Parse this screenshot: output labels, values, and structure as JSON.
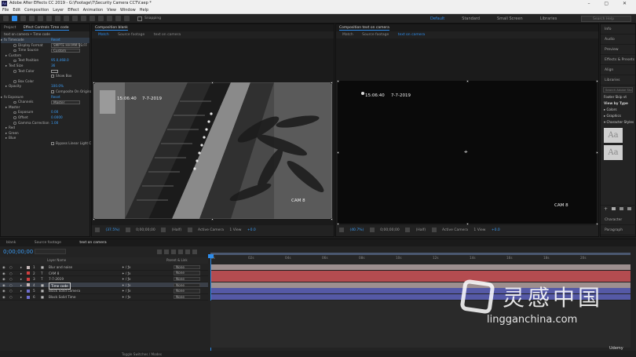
{
  "window": {
    "title": "Adobe After Effects CC 2019 - G:\\Footage\\7\\Security Camera CCTV.aep *"
  },
  "menu": [
    "File",
    "Edit",
    "Composition",
    "Layer",
    "Effect",
    "Animation",
    "View",
    "Window",
    "Help"
  ],
  "toolbar": {
    "snapping_label": "Snapping",
    "workspaces": [
      "Default",
      "Standard",
      "Small Screen",
      "Libraries"
    ],
    "active_workspace": "Default",
    "search_placeholder": "Search Help"
  },
  "effect_controls": {
    "tabs": [
      "Project",
      "Effect Controls Time code"
    ],
    "breadcrumb": "text on camera • Time code",
    "rows": [
      {
        "label": "fx  Timecode",
        "value": "Reset",
        "indent": 0,
        "kind": "value",
        "highlight": true
      },
      {
        "label": "Display Format",
        "value": "SMPTE HH:MM:SS:FF",
        "indent": 2,
        "kind": "select"
      },
      {
        "label": "Time Source",
        "value": "Custom",
        "indent": 2,
        "kind": "select"
      },
      {
        "label": "Custom",
        "value": "",
        "indent": 1,
        "kind": "none"
      },
      {
        "label": "Text Position",
        "value": "95.0,468.0",
        "indent": 2,
        "kind": "value"
      },
      {
        "label": "Text Size",
        "value": "36",
        "indent": 1,
        "kind": "value"
      },
      {
        "label": "Text Color",
        "value": "",
        "indent": 2,
        "kind": "swatch"
      },
      {
        "label": "",
        "value": "Show Box",
        "indent": 2,
        "kind": "check"
      },
      {
        "label": "Box Color",
        "value": "",
        "indent": 2,
        "kind": "none"
      },
      {
        "label": "Opacity",
        "value": "100.0%",
        "indent": 1,
        "kind": "value"
      },
      {
        "label": "",
        "value": "Composite On Original",
        "indent": 2,
        "kind": "check"
      },
      {
        "label": "fx  Exposure",
        "value": "Reset",
        "indent": 0,
        "kind": "value"
      },
      {
        "label": "Channels",
        "value": "Master",
        "indent": 2,
        "kind": "select"
      },
      {
        "label": "Master",
        "value": "",
        "indent": 1,
        "kind": "none"
      },
      {
        "label": "Exposure",
        "value": "0.00",
        "indent": 2,
        "kind": "value"
      },
      {
        "label": "Offset",
        "value": "0.0000",
        "indent": 2,
        "kind": "value"
      },
      {
        "label": "Gamma Correction",
        "value": "1.00",
        "indent": 2,
        "kind": "value"
      },
      {
        "label": "Red",
        "value": "",
        "indent": 1,
        "kind": "none"
      },
      {
        "label": "Green",
        "value": "",
        "indent": 1,
        "kind": "none"
      },
      {
        "label": "Blue",
        "value": "",
        "indent": 1,
        "kind": "none"
      },
      {
        "label": "",
        "value": "Bypass Linear Light Conversion",
        "indent": 2,
        "kind": "check"
      }
    ]
  },
  "viewer_left": {
    "tab": "Composition blank",
    "subtabs": [
      "Match",
      "Source footage",
      "text on camera"
    ],
    "active_subtab": "Match",
    "time_overlay": "15:06:40",
    "date_overlay": "7-7-2019",
    "cam_label": "CAM 8",
    "footer": {
      "zoom": "(37.5%)",
      "timecode": "0;00;00;00",
      "resolution": "(Half)",
      "camera": "Active Camera",
      "views": "1 View",
      "exposure": "+0.0"
    }
  },
  "viewer_right": {
    "tab": "Composition text on camera",
    "subtabs": [
      "Match",
      "Source footage",
      "text on camera"
    ],
    "active_subtab": "text on camera",
    "time_overlay": "15:06:40",
    "date_overlay": "7-7-2019",
    "cam_label": "CAM 8",
    "footer": {
      "zoom": "(40.7%)",
      "timecode": "0;00;00;00",
      "resolution": "(Half)",
      "camera": "Active Camera",
      "views": "1 View",
      "exposure": "+0.0"
    }
  },
  "right_panel": {
    "items": [
      "Info",
      "Audio",
      "Preview",
      "Effects & Presets",
      "Align",
      "Libraries"
    ],
    "libraries_search": "Search Adobe Stock",
    "library_name": "Footer Skip vt",
    "view_by": "View by Type",
    "sections": [
      "Colors",
      "Graphics",
      "Character Styles"
    ],
    "char_style_sample": "Aa",
    "bottom_items": [
      "Character",
      "Paragraph"
    ]
  },
  "timeline": {
    "tabs": [
      "blank",
      "Source footage",
      "text on camera"
    ],
    "active_tab": "text on camera",
    "timecode": "0;00;00;00",
    "columns": {
      "layer": "Layer Name",
      "parent": "Parent & Link"
    },
    "layers": [
      {
        "num": "1",
        "name": "Blur and noise",
        "parent": "None",
        "color": "#c6b8b8",
        "bar": "#9d8f8f"
      },
      {
        "num": "2",
        "name": "CAM 8",
        "parent": "None",
        "color": "#d04040",
        "bar": "#b44c50"
      },
      {
        "num": "3",
        "name": "7-7-2019",
        "parent": "None",
        "color": "#d04040",
        "bar": "#b44c50"
      },
      {
        "num": "4",
        "name": "Time code",
        "parent": "None",
        "color": "#c6b8b8",
        "bar": "#9d8f8f"
      },
      {
        "num": "5",
        "name": "Black Solid camera",
        "parent": "None",
        "color": "#7070d0",
        "bar": "#5559a6"
      },
      {
        "num": "6",
        "name": "Black Solid Time",
        "parent": "None",
        "color": "#7070d0",
        "bar": "#5559a6"
      }
    ],
    "selected_layer": 3,
    "ruler_ticks": [
      "0s",
      "02s",
      "04s",
      "06s",
      "08s",
      "10s",
      "12s",
      "14s",
      "16s",
      "18s",
      "20s"
    ],
    "footer_label": "Toggle Switches / Modes"
  },
  "watermark": {
    "cn": "灵感中国",
    "en": "lingganchina.com",
    "badge": "Udemy"
  },
  "colors": {
    "accent": "#2d8ceb",
    "value_blue": "#3b9bf2"
  }
}
